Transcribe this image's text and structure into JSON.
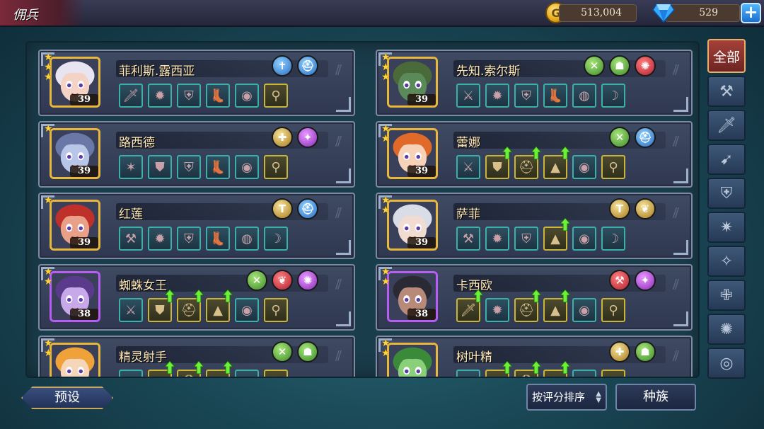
{
  "header": {
    "title": "佣兵",
    "gold": "513,004",
    "gems": "529",
    "coin_letter": "G",
    "plus_label": "+"
  },
  "filters": {
    "all_label": "全部",
    "icons": [
      "hammer-icon",
      "sword-icon",
      "bow-icon",
      "shield-icon",
      "shuriken-icon",
      "claw-icon",
      "cross-icon",
      "swirl-icon",
      "circle-icon"
    ]
  },
  "heroes": [
    {
      "name": "菲利斯.露西亚",
      "level": "39",
      "stars": 3,
      "frame": "gold",
      "skin": "#f4d3c6",
      "hair": "#e8e4f2",
      "races": [
        {
          "c": "blue",
          "g": "✝"
        },
        {
          "c": "blue",
          "g": "⛑"
        }
      ],
      "equip": [
        {
          "g": "🗡",
          "t": "teal",
          "u": false
        },
        {
          "g": "✹",
          "t": "teal",
          "u": false
        },
        {
          "g": "⛨",
          "t": "teal",
          "u": false
        },
        {
          "g": "👢",
          "t": "teal",
          "u": false
        },
        {
          "g": "◉",
          "t": "teal",
          "u": false
        },
        {
          "g": "⚲",
          "t": "gold",
          "u": false
        }
      ]
    },
    {
      "name": "先知.索尔斯",
      "level": "39",
      "stars": 3,
      "frame": "gold",
      "skin": "#5a8a5a",
      "hair": "#4a6a3a",
      "races": [
        {
          "c": "green",
          "g": "✕"
        },
        {
          "c": "green",
          "g": "☗"
        },
        {
          "c": "red",
          "g": "✺"
        }
      ],
      "equip": [
        {
          "g": "⚔",
          "t": "teal",
          "u": false
        },
        {
          "g": "✹",
          "t": "teal",
          "u": false
        },
        {
          "g": "⛨",
          "t": "teal",
          "u": false
        },
        {
          "g": "👢",
          "t": "teal",
          "u": false
        },
        {
          "g": "◍",
          "t": "teal",
          "u": false
        },
        {
          "g": "☽",
          "t": "teal",
          "u": false
        }
      ]
    },
    {
      "name": "路西德",
      "level": "39",
      "stars": 1,
      "frame": "gold",
      "skin": "#b8c6e8",
      "hair": "#6a78a8",
      "races": [
        {
          "c": "gold",
          "g": "✚"
        },
        {
          "c": "purple",
          "g": "✦"
        }
      ],
      "equip": [
        {
          "g": "✶",
          "t": "teal",
          "u": false
        },
        {
          "g": "⛊",
          "t": "teal",
          "u": false
        },
        {
          "g": "⛨",
          "t": "teal",
          "u": false
        },
        {
          "g": "👢",
          "t": "teal",
          "u": false
        },
        {
          "g": "◉",
          "t": "teal",
          "u": false
        },
        {
          "g": "⚲",
          "t": "gold",
          "u": false
        }
      ]
    },
    {
      "name": "蕾娜",
      "level": "39",
      "stars": 2,
      "frame": "gold",
      "skin": "#f6d2b8",
      "hair": "#e06a2a",
      "races": [
        {
          "c": "green",
          "g": "✕"
        },
        {
          "c": "blue",
          "g": "⛑"
        }
      ],
      "equip": [
        {
          "g": "⚔",
          "t": "teal",
          "u": false
        },
        {
          "g": "⛊",
          "t": "gold",
          "u": true
        },
        {
          "g": "⛑",
          "t": "gold",
          "u": true
        },
        {
          "g": "▲",
          "t": "gold",
          "u": true
        },
        {
          "g": "◉",
          "t": "teal",
          "u": false
        },
        {
          "g": "⚲",
          "t": "gold",
          "u": false
        }
      ]
    },
    {
      "name": "红莲",
      "level": "39",
      "stars": 1,
      "frame": "gold",
      "skin": "#e8a088",
      "hair": "#c0302a",
      "races": [
        {
          "c": "gold",
          "g": "T"
        },
        {
          "c": "blue",
          "g": "⛑"
        }
      ],
      "equip": [
        {
          "g": "⚒",
          "t": "teal",
          "u": false
        },
        {
          "g": "✹",
          "t": "teal",
          "u": false
        },
        {
          "g": "⛨",
          "t": "teal",
          "u": false
        },
        {
          "g": "👢",
          "t": "teal",
          "u": false
        },
        {
          "g": "◍",
          "t": "teal",
          "u": false
        },
        {
          "g": "☽",
          "t": "teal",
          "u": false
        }
      ]
    },
    {
      "name": "萨菲",
      "level": "39",
      "stars": 2,
      "frame": "gold",
      "skin": "#f0dcd0",
      "hair": "#d8dde8",
      "races": [
        {
          "c": "gold",
          "g": "T"
        },
        {
          "c": "gold",
          "g": "❦"
        }
      ],
      "equip": [
        {
          "g": "⚒",
          "t": "teal",
          "u": false
        },
        {
          "g": "✹",
          "t": "teal",
          "u": false
        },
        {
          "g": "⛨",
          "t": "teal",
          "u": false
        },
        {
          "g": "▲",
          "t": "gold",
          "u": true
        },
        {
          "g": "◉",
          "t": "teal",
          "u": false
        },
        {
          "g": "☽",
          "t": "teal",
          "u": false
        }
      ]
    },
    {
      "name": "蜘蛛女王",
      "level": "38",
      "stars": 2,
      "frame": "purple",
      "skin": "#c7a8e8",
      "hair": "#5a3a8a",
      "races": [
        {
          "c": "green",
          "g": "✕"
        },
        {
          "c": "red",
          "g": "❦"
        },
        {
          "c": "purple",
          "g": "✺"
        }
      ],
      "equip": [
        {
          "g": "⚔",
          "t": "teal",
          "u": false
        },
        {
          "g": "⛊",
          "t": "gold",
          "u": true
        },
        {
          "g": "⛑",
          "t": "gold",
          "u": true
        },
        {
          "g": "▲",
          "t": "gold",
          "u": true
        },
        {
          "g": "◉",
          "t": "teal",
          "u": false
        },
        {
          "g": "⚲",
          "t": "gold",
          "u": false
        }
      ]
    },
    {
      "name": "卡西欧",
      "level": "38",
      "stars": 2,
      "frame": "purple",
      "skin": "#b88a7a",
      "hair": "#2a2a34",
      "races": [
        {
          "c": "red",
          "g": "⚒"
        },
        {
          "c": "purple",
          "g": "✦"
        }
      ],
      "equip": [
        {
          "g": "🗡",
          "t": "gold",
          "u": true
        },
        {
          "g": "✹",
          "t": "teal",
          "u": false
        },
        {
          "g": "⛑",
          "t": "gold",
          "u": true
        },
        {
          "g": "▲",
          "t": "gold",
          "u": true
        },
        {
          "g": "◉",
          "t": "teal",
          "u": false
        },
        {
          "g": "⚲",
          "t": "gold",
          "u": false
        }
      ]
    },
    {
      "name": "精灵射手",
      "level": "",
      "stars": 2,
      "frame": "gold",
      "skin": "#f6d6b8",
      "hair": "#f0a23a",
      "races": [
        {
          "c": "green",
          "g": "✕"
        },
        {
          "c": "green",
          "g": "☗"
        }
      ],
      "equip": [
        {
          "g": "⚔",
          "t": "teal",
          "u": false
        },
        {
          "g": "⛊",
          "t": "gold",
          "u": true
        },
        {
          "g": "⛑",
          "t": "gold",
          "u": true
        },
        {
          "g": "▲",
          "t": "gold",
          "u": true
        },
        {
          "g": "◉",
          "t": "teal",
          "u": false
        },
        {
          "g": "⚲",
          "t": "gold",
          "u": false
        }
      ]
    },
    {
      "name": "树叶精",
      "level": "",
      "stars": 2,
      "frame": "gold",
      "skin": "#8ad07a",
      "hair": "#3a8a3a",
      "races": [
        {
          "c": "gold",
          "g": "✚"
        },
        {
          "c": "green",
          "g": "☗"
        }
      ],
      "equip": [
        {
          "g": "⚔",
          "t": "teal",
          "u": false
        },
        {
          "g": "⛊",
          "t": "gold",
          "u": true
        },
        {
          "g": "⛑",
          "t": "gold",
          "u": true
        },
        {
          "g": "▲",
          "t": "gold",
          "u": true
        },
        {
          "g": "◉",
          "t": "teal",
          "u": false
        },
        {
          "g": "⚲",
          "t": "gold",
          "u": false
        }
      ]
    }
  ],
  "footer": {
    "preset_label": "预设",
    "sort_label": "按评分排序",
    "race_label": "种族"
  }
}
